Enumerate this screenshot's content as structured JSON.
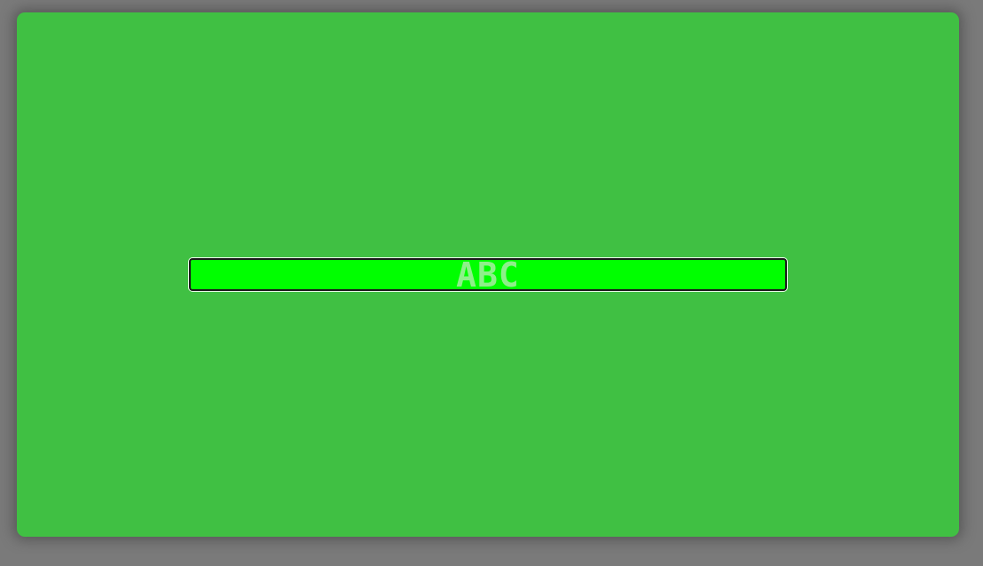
{
  "prompt": {
    "text": ""
  },
  "input": {
    "value": "ABC",
    "accent": "#00ff00",
    "background": "#40c043"
  }
}
